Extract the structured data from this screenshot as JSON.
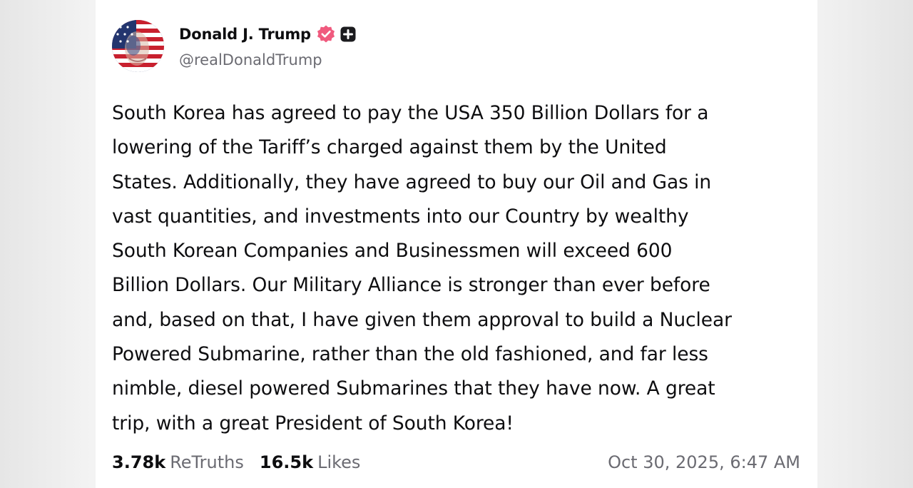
{
  "profile": {
    "display_name": "Donald J. Trump",
    "handle": "@realDonaldTrump",
    "avatar_icon": "flag-portrait-avatar",
    "verified_icon": "verified-badge-icon",
    "verified_color": "#f05a7e",
    "plus_icon": "plus-badge-icon"
  },
  "post": {
    "lines": [
      "South Korea has agreed to pay the USA 350 Billion Dollars for a",
      "lowering of the Tariff’s charged against them by the United",
      "States. Additionally, they have agreed to buy our Oil and Gas in",
      "vast quantities, and investments into our Country by wealthy",
      "South Korean Companies and Businessmen will exceed 600",
      "Billion Dollars. Our Military Alliance is stronger than ever before",
      "and, based on that, I have given them approval to build a Nuclear",
      "Powered Submarine, rather than the old fashioned, and far less",
      "nimble, diesel powered Submarines that they have now. A great",
      "trip, with a great President of South Korea!"
    ]
  },
  "stats": {
    "retruths_count": "3.78k",
    "retruths_label": "ReTruths",
    "likes_count": "16.5k",
    "likes_label": "Likes"
  },
  "timestamp": "Oct 30, 2025, 6:47 AM"
}
